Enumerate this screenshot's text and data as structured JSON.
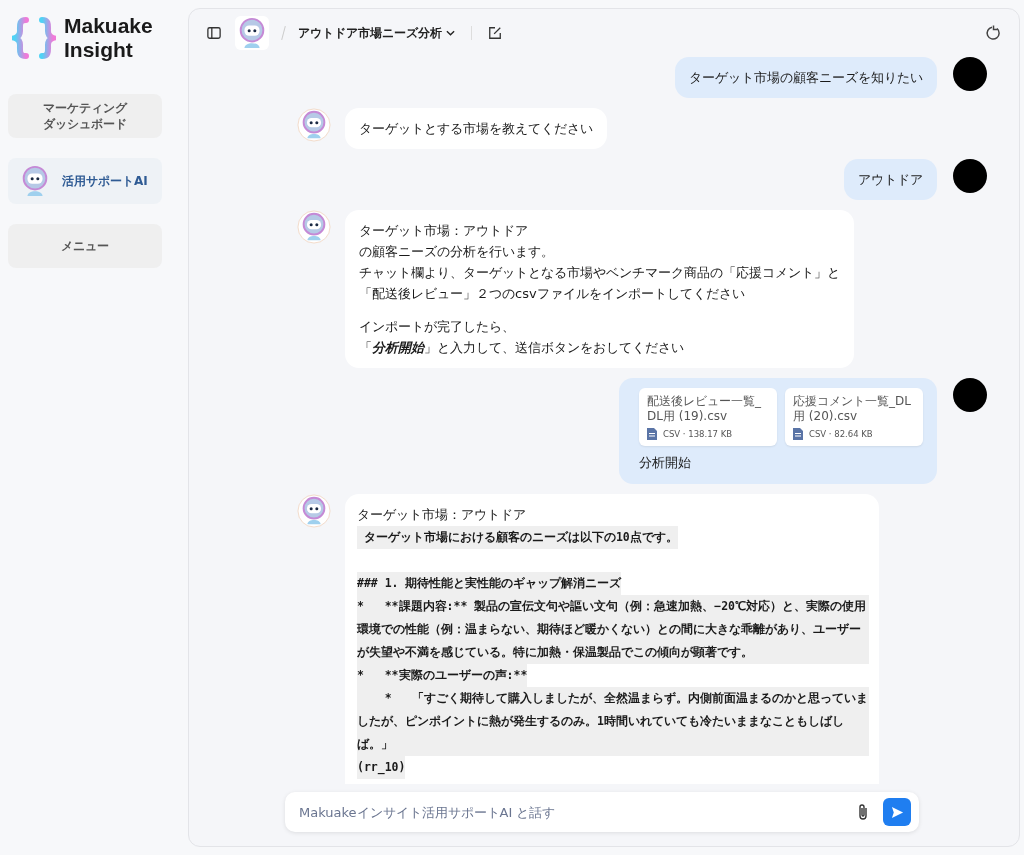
{
  "sidebar": {
    "logo": {
      "line1": "Makuake",
      "line2": "Insight"
    },
    "items": [
      {
        "lines": [
          "マーケティング",
          "ダッシュボード"
        ],
        "kind": "text",
        "selected": false
      },
      {
        "lines": [
          "活用サポートAI"
        ],
        "kind": "robot",
        "selected": true
      },
      {
        "lines": [
          "メニュー"
        ],
        "kind": "text",
        "selected": false
      }
    ]
  },
  "header": {
    "title": "アウトドア市場ニーズ分析"
  },
  "messages": [
    {
      "kind": "user",
      "text": "ターゲット市場の顧客ニーズを知りたい"
    },
    {
      "kind": "bot",
      "paragraphs": [
        [
          "ターゲットとする市場を教えてください"
        ]
      ]
    },
    {
      "kind": "user",
      "text": "アウトドア"
    },
    {
      "kind": "bot",
      "paragraphs": [
        [
          "ターゲット市場：アウトドア",
          "の顧客ニーズの分析を行います。",
          "チャット欄より、ターゲットとなる市場やベンチマーク商品の「応援コメント」と",
          "「配送後レビュー」２つのcsvファイルをインポートしてください"
        ],
        [
          "インポートが完了したら、",
          "「**分析開始**」と入力して、送信ボタンをおしてください"
        ]
      ]
    },
    {
      "kind": "files",
      "files": [
        {
          "name": "配送後レビュー一覧_DL用 (19).csv",
          "meta": "CSV · 138.17 KB"
        },
        {
          "name": "応援コメント一覧_DL用 (20).csv",
          "meta": "CSV · 82.64 KB"
        }
      ],
      "text": "分析開始"
    },
    {
      "kind": "code",
      "heading": "ターゲット市場：アウトドア",
      "blocks": [
        [
          " ターゲット市場における顧客のニーズは以下の10点です。"
        ],
        [
          "### 1. 期待性能と実性能のギャップ解消ニーズ",
          "*   **課題内容:** 製品の宣伝文句や謳い文句（例：急速加熱、−20℃対応）と、実際の使用環境での性能（例：温まらない、期待ほど暖かくない）との間に大きな乖離があり、ユーザーが失望や不満を感じている。特に加熱・保温製品でこの傾向が顕著です。",
          "*   **実際のユーザーの声:**",
          "    *   「すごく期待して購入しましたが、全然温まらず。内側前面温まるのかと思っていましたが、ピンポイントに熱が発生するのみ。1時間いれていても冷たいままなこともしばしば。」",
          "(rr_10)"
        ]
      ]
    }
  ],
  "composer": {
    "placeholder": "Makuakeインサイト活用サポートAI と話す"
  }
}
